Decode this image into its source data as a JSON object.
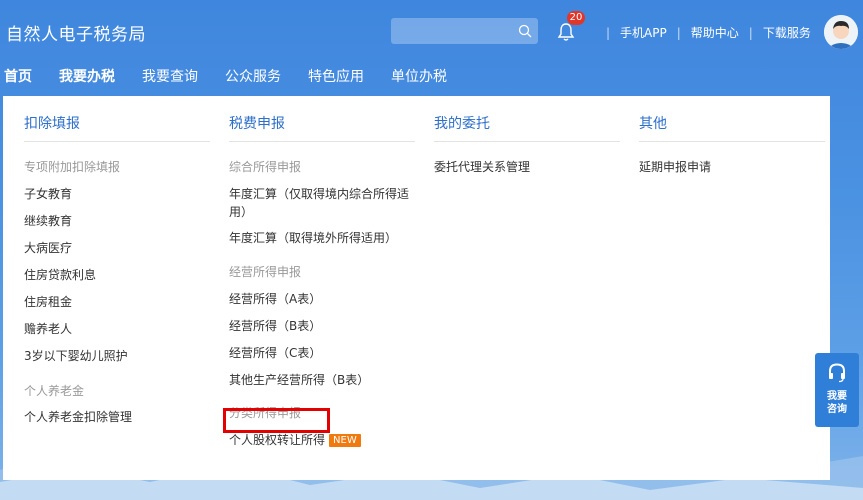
{
  "header": {
    "site_title": "自然人电子税务局",
    "search_placeholder": "",
    "notification_count": "20",
    "links": [
      "手机APP",
      "帮助中心",
      "下载服务"
    ]
  },
  "nav": {
    "items": [
      "首页",
      "我要办税",
      "我要查询",
      "公众服务",
      "特色应用",
      "单位办税"
    ]
  },
  "menu": {
    "col1": {
      "header": "扣除填报",
      "section1": "专项附加扣除填报",
      "items1": [
        "子女教育",
        "继续教育",
        "大病医疗",
        "住房贷款利息",
        "住房租金",
        "赡养老人",
        "3岁以下婴幼儿照护"
      ],
      "section2": "个人养老金",
      "items2": [
        "个人养老金扣除管理"
      ]
    },
    "col2": {
      "header": "税费申报",
      "section1": "综合所得申报",
      "items1": [
        "年度汇算（仅取得境内综合所得适用）",
        "年度汇算（取得境外所得适用）"
      ],
      "section2": "经营所得申报",
      "items2": [
        "经营所得（A表）",
        "经营所得（B表）",
        "经营所得（C表）",
        "其他生产经营所得（B表）"
      ],
      "section3": "分类所得申报",
      "items3": [
        "个人股权转让所得"
      ],
      "new_badge": "NEW"
    },
    "col3": {
      "header": "我的委托",
      "items": [
        "委托代理关系管理"
      ]
    },
    "col4": {
      "header": "其他",
      "items": [
        "延期申报申请"
      ]
    }
  },
  "consult": {
    "line1": "我要",
    "line2": "咨询"
  },
  "colors": {
    "accent": "#2e6fca",
    "highlight": "#e30000",
    "badge": "#e0372a",
    "new_badge": "#f07a10"
  }
}
